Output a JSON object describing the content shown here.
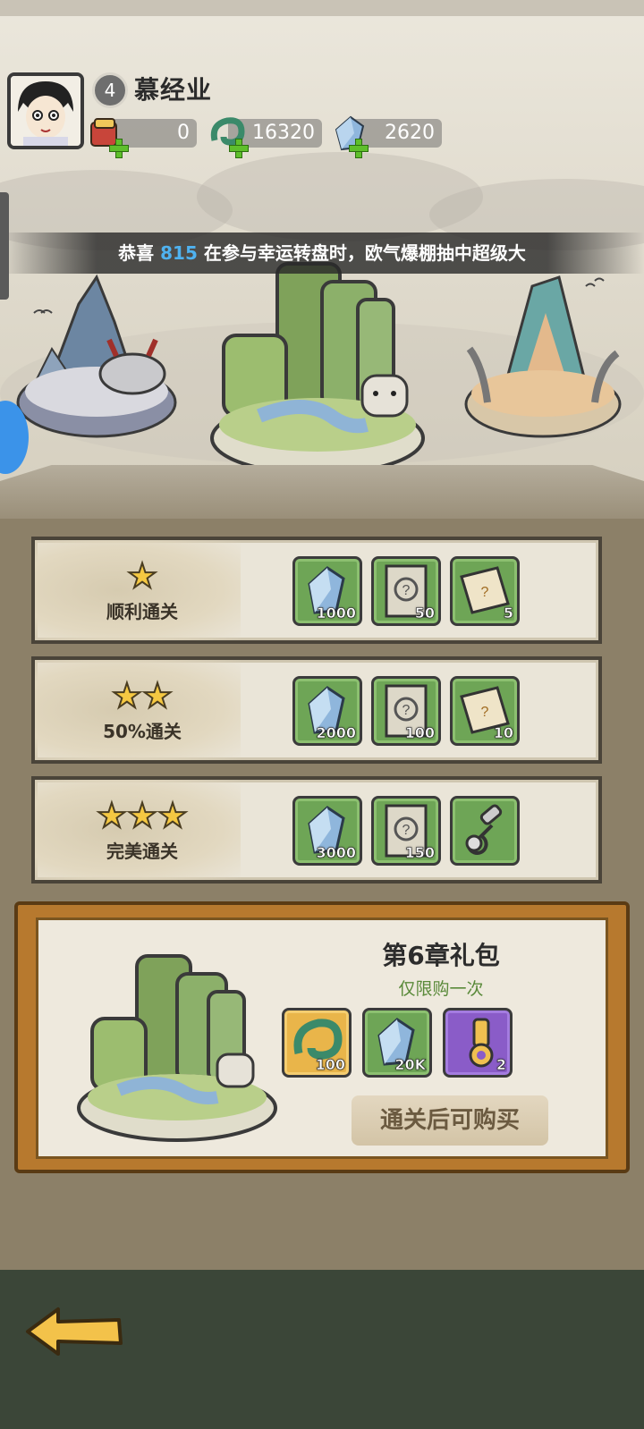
{
  "player": {
    "name": "慕经业",
    "level": "4",
    "scrolls": "0",
    "jade": "16320",
    "crystals": "2620"
  },
  "announcement": {
    "prefix": "恭喜 ",
    "number": "815",
    "suffix": " 在参与幸运转盘时，欧气爆棚抽中超级大"
  },
  "rewards": [
    {
      "stars": 1,
      "label": "顺利通关",
      "items": [
        {
          "icon": "crystal-icon",
          "count": "1000"
        },
        {
          "icon": "mystery-card-icon",
          "count": "50"
        },
        {
          "icon": "mystery-scroll-icon",
          "count": "5"
        }
      ]
    },
    {
      "stars": 2,
      "label": "50%通关",
      "items": [
        {
          "icon": "crystal-icon",
          "count": "2000"
        },
        {
          "icon": "mystery-card-icon",
          "count": "100"
        },
        {
          "icon": "mystery-scroll-icon",
          "count": "10"
        }
      ]
    },
    {
      "stars": 3,
      "label": "完美通关",
      "items": [
        {
          "icon": "crystal-icon",
          "count": "3000"
        },
        {
          "icon": "mystery-card-icon",
          "count": "150"
        },
        {
          "icon": "key-icon",
          "count": ""
        }
      ]
    }
  ],
  "gift": {
    "title": "第6章礼包",
    "subtitle": "仅限购一次",
    "items": [
      {
        "icon": "jade-dragon-icon",
        "count": "100",
        "color": "#e9b54a"
      },
      {
        "icon": "crystal-icon",
        "count": "20K",
        "color": "#6ea556"
      },
      {
        "icon": "golden-key-icon",
        "count": "2",
        "color": "#8a5cc8"
      }
    ],
    "button_label": "通关后可购买"
  },
  "colors": {
    "item_green": "#6ea556",
    "star_gold": "#f5c842",
    "highlight_blue": "#4fb2f0"
  }
}
